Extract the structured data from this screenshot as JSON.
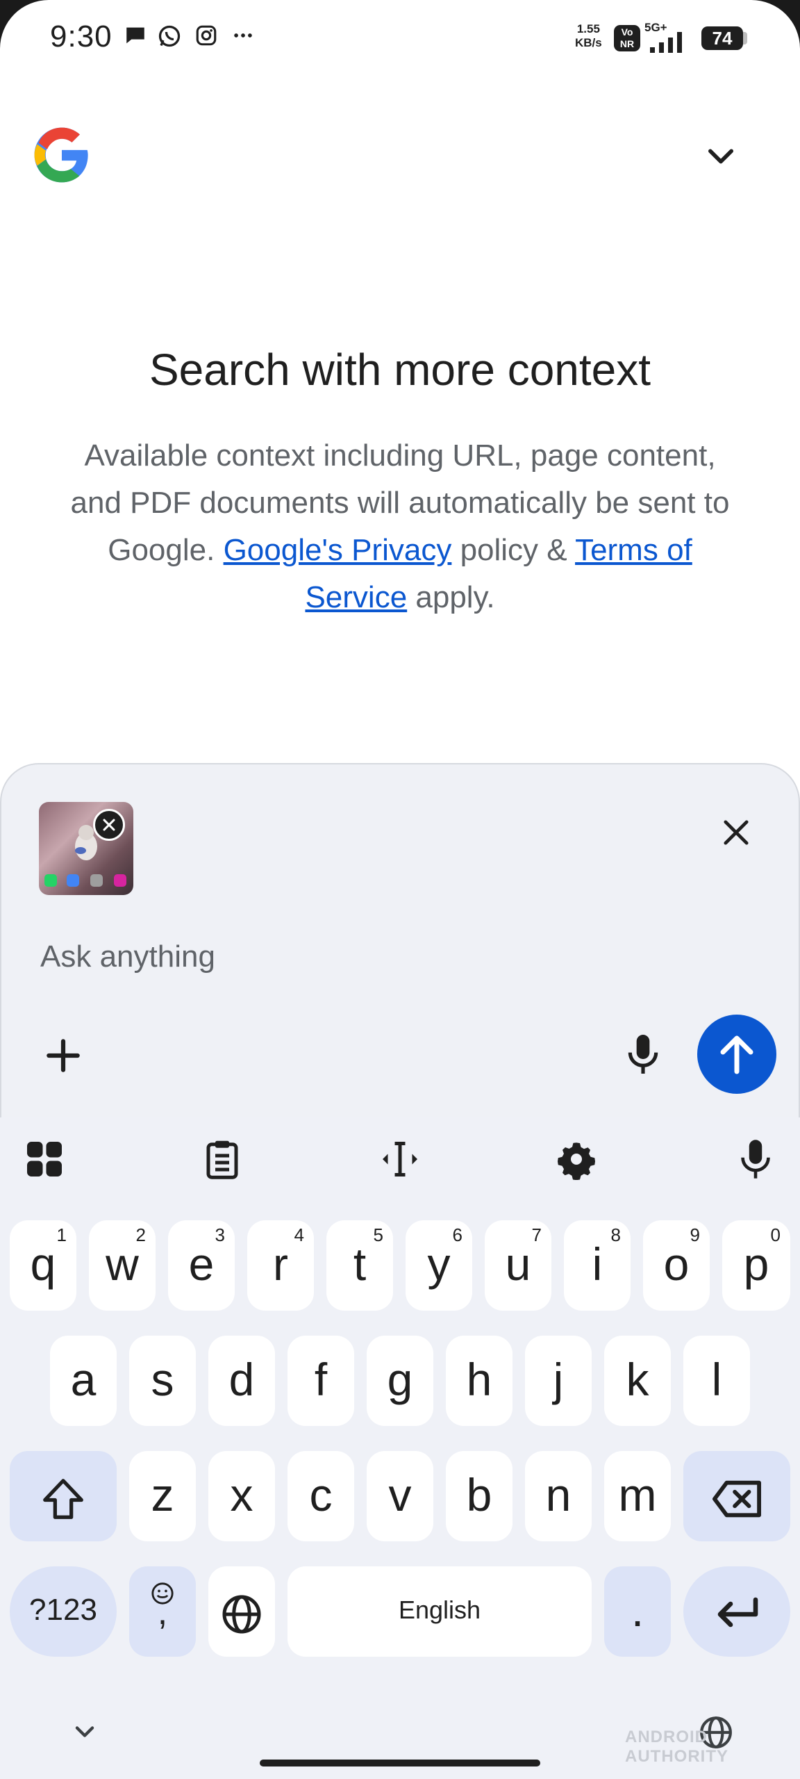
{
  "status_bar": {
    "time": "9:30",
    "speed_value": "1.55",
    "speed_unit": "KB/s",
    "volte": "Vo NR",
    "network": "5G+",
    "battery": "74"
  },
  "header": {
    "logo": "google-g-logo",
    "account_icon": "chevron-down-icon"
  },
  "intro": {
    "headline": "Search with more context",
    "desc_before": "Available context including URL, page content, and PDF documents will automatically be sent to Google. ",
    "privacy_link": "Google's Privacy",
    "desc_middle": " policy & ",
    "terms_link": "Terms of Service",
    "desc_after": " apply."
  },
  "composer": {
    "placeholder": "Ask anything",
    "attachment": "screenshot-thumbnail"
  },
  "keyboard": {
    "row1": [
      {
        "k": "q",
        "h": "1"
      },
      {
        "k": "w",
        "h": "2"
      },
      {
        "k": "e",
        "h": "3"
      },
      {
        "k": "r",
        "h": "4"
      },
      {
        "k": "t",
        "h": "5"
      },
      {
        "k": "y",
        "h": "6"
      },
      {
        "k": "u",
        "h": "7"
      },
      {
        "k": "i",
        "h": "8"
      },
      {
        "k": "o",
        "h": "9"
      },
      {
        "k": "p",
        "h": "0"
      }
    ],
    "row2": [
      "a",
      "s",
      "d",
      "f",
      "g",
      "h",
      "j",
      "k",
      "l"
    ],
    "row3": [
      "z",
      "x",
      "c",
      "v",
      "b",
      "n",
      "m"
    ],
    "symbols": "?123",
    "emoji_comma": ",",
    "space": "English",
    "period": "."
  },
  "watermark": "ANDROID AUTHORITY",
  "colors": {
    "accent": "#0b57d0",
    "panel": "#eff1f6",
    "special_key": "#dce3f7"
  }
}
